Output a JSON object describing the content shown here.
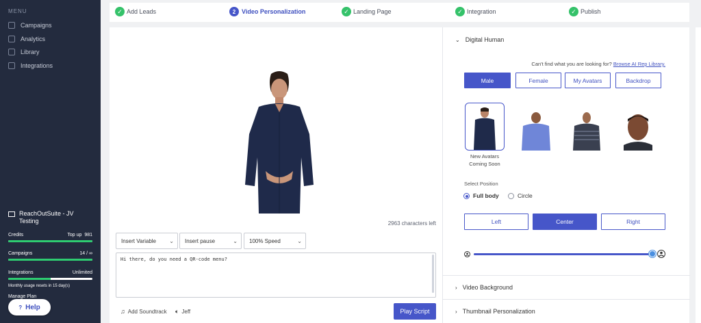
{
  "sidebar": {
    "menu_title": "MENU",
    "items": [
      {
        "label": "Campaigns",
        "icon": "grid-icon"
      },
      {
        "label": "Analytics",
        "icon": "chart-icon"
      },
      {
        "label": "Library",
        "icon": "book-icon"
      },
      {
        "label": "Integrations",
        "icon": "puzzle-icon"
      }
    ],
    "account_name": "ReachOutSuite - JV Testing",
    "credits": {
      "label": "Credits",
      "topup_label": "Top up",
      "value": "981",
      "fill": 1.0
    },
    "campaigns": {
      "label": "Campaigns",
      "value": "14 / ∞",
      "fill": 1.0
    },
    "integrations": {
      "label": "Integrations",
      "value": "Unlimited",
      "fill": 0.5
    },
    "usage_note": "Monthly usage resets in 15 day(s)",
    "manage_plan": "Manage Plan",
    "help_label": "Help"
  },
  "steps": [
    {
      "label": "Add Leads",
      "state": "done"
    },
    {
      "label": "Video Personalization",
      "state": "active",
      "number": "2"
    },
    {
      "label": "Landing Page",
      "state": "done"
    },
    {
      "label": "Integration",
      "state": "done"
    },
    {
      "label": "Publish",
      "state": "done"
    }
  ],
  "editor": {
    "chars_left": "2963 characters left",
    "insert_variable": "Insert Variable",
    "insert_pause": "Insert pause",
    "speed": "100% Speed",
    "script_text": "Hi there, do you need a QR-code menu?",
    "add_soundtrack": "Add Soundtrack",
    "voice": "Jeff",
    "play_script": "Play Script"
  },
  "digital_human": {
    "title": "Digital Human",
    "cant_find": "Can't find what you are looking for?",
    "browse_link": "Browse AI Rep Library.",
    "gender_buttons": [
      "Male",
      "Female",
      "My Avatars",
      "Backdrop"
    ],
    "avatar_caption_line1": "New Avatars",
    "avatar_caption_line2": "Coming Soon",
    "position_title": "Select Position",
    "radio_full": "Full body",
    "radio_circle": "Circle",
    "position_buttons": [
      "Left",
      "Center",
      "Right"
    ],
    "zoom_level": 1.0
  },
  "sections": {
    "video_background": "Video Background",
    "thumbnail": "Thumbnail Personalization"
  },
  "colors": {
    "accent": "#4656c9",
    "success": "#35c26a",
    "sidebar": "#232b3e"
  }
}
